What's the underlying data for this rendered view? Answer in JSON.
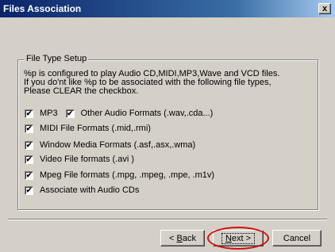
{
  "window": {
    "title": "Files Association",
    "close_glyph": "x"
  },
  "group": {
    "legend": "File Type Setup",
    "description": [
      "%p  is configured to play Audio CD,MIDI,MP3,Wave and VCD  files.",
      "If you do'nt  like %p to be associated with the following file types,",
      "Please CLEAR the checkbox."
    ],
    "checkboxes": {
      "mp3": {
        "label": "MP3",
        "checked": true
      },
      "other_audio": {
        "label": "Other Audio Formats (.wav,.cda...)",
        "checked": true
      },
      "midi": {
        "label": "MIDI File Formats (.mid,.rmi)",
        "checked": true
      },
      "wmedia": {
        "label": "Window Media Formats (.asf,.asx,.wma)",
        "checked": true
      },
      "video": {
        "label": "Video File formats (.avi )",
        "checked": true
      },
      "mpeg": {
        "label": "Mpeg File formats (.mpg, .mpeg, .mpe, .m1v)",
        "checked": true
      },
      "audio_cd": {
        "label": "Associate with Audio CDs",
        "checked": true
      }
    },
    "check_glyph": "✔"
  },
  "buttons": {
    "back_prefix": "< ",
    "back_accel": "B",
    "back_rest": "ack",
    "next_accel": "N",
    "next_rest": "ext >",
    "cancel": "Cancel"
  },
  "colors": {
    "title_bar": "#0a246a",
    "highlight_ring": "#d01010",
    "dialog_face": "#d4d0c8"
  }
}
